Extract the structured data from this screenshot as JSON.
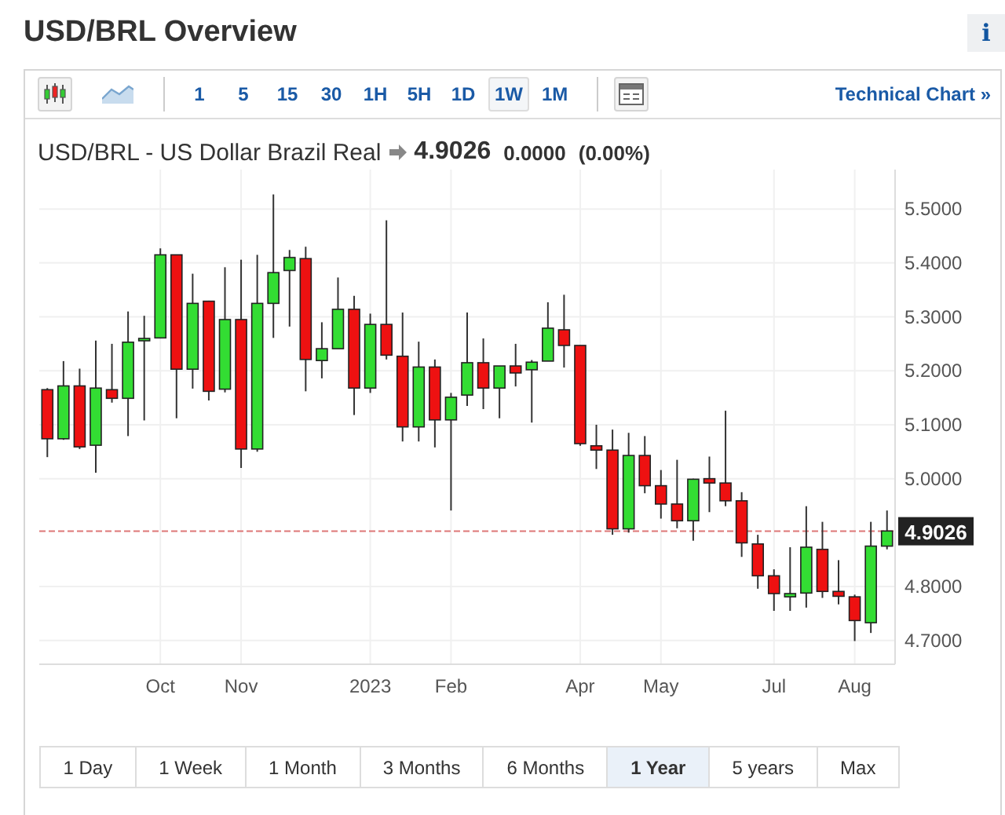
{
  "header": {
    "title": "USD/BRL Overview",
    "info_button": "i"
  },
  "toolbar": {
    "chart_types": [
      {
        "kind": "candles",
        "selected": true
      },
      {
        "kind": "area",
        "selected": false
      }
    ],
    "intervals": [
      {
        "label": "1",
        "selected": false
      },
      {
        "label": "5",
        "selected": false
      },
      {
        "label": "15",
        "selected": false
      },
      {
        "label": "30",
        "selected": false
      },
      {
        "label": "1H",
        "selected": false
      },
      {
        "label": "5H",
        "selected": false
      },
      {
        "label": "1D",
        "selected": false
      },
      {
        "label": "1W",
        "selected": true
      },
      {
        "label": "1M",
        "selected": false
      }
    ],
    "link": "Technical Chart »"
  },
  "quote": {
    "name": "USD/BRL - US Dollar Brazil Real",
    "price": "4.9026",
    "change": "0.0000",
    "change_pct": "(0.00%)"
  },
  "chart": {
    "chart_data": {
      "type": "candlestick",
      "grid": true,
      "ylim": [
        4.656,
        5.573
      ],
      "yticks": [
        {
          "value": 4.7,
          "label": "4.7000"
        },
        {
          "value": 4.8,
          "label": "4.8000"
        },
        {
          "value": 5.0,
          "label": "5.0000"
        },
        {
          "value": 5.1,
          "label": "5.1000"
        },
        {
          "value": 5.2,
          "label": "5.2000"
        },
        {
          "value": 5.3,
          "label": "5.3000"
        },
        {
          "value": 5.4,
          "label": "5.4000"
        },
        {
          "value": 5.5,
          "label": "5.5000"
        }
      ],
      "ref_lines": [
        {
          "axis": "y",
          "value": 4.9026,
          "label": "4.9026",
          "color": "#dd7777"
        }
      ],
      "categories": [
        null,
        null,
        null,
        null,
        null,
        null,
        null,
        "Oct",
        null,
        null,
        null,
        null,
        "Nov",
        null,
        null,
        null,
        null,
        null,
        null,
        null,
        "2023",
        null,
        null,
        null,
        null,
        "Feb",
        null,
        null,
        null,
        null,
        null,
        null,
        null,
        "Apr",
        null,
        null,
        null,
        null,
        "May",
        null,
        null,
        null,
        null,
        null,
        null,
        "Jul",
        null,
        null,
        null,
        null,
        "Aug",
        null,
        null
      ],
      "ohlc": [
        [
          5.165,
          5.168,
          5.04,
          5.074
        ],
        [
          5.074,
          5.218,
          5.072,
          5.172
        ],
        [
          5.172,
          5.204,
          5.055,
          5.059
        ],
        [
          5.062,
          5.256,
          5.011,
          5.168
        ],
        [
          5.165,
          5.25,
          5.141,
          5.149
        ],
        [
          5.149,
          5.31,
          5.079,
          5.253
        ],
        [
          5.256,
          5.302,
          5.108,
          5.26
        ],
        [
          5.261,
          5.427,
          5.26,
          5.415
        ],
        [
          5.415,
          5.415,
          5.112,
          5.203
        ],
        [
          5.203,
          5.38,
          5.167,
          5.325
        ],
        [
          5.329,
          5.33,
          5.145,
          5.162
        ],
        [
          5.166,
          5.392,
          5.16,
          5.295
        ],
        [
          5.295,
          5.406,
          5.02,
          5.055
        ],
        [
          5.055,
          5.415,
          5.05,
          5.325
        ],
        [
          5.325,
          5.527,
          5.261,
          5.382
        ],
        [
          5.386,
          5.424,
          5.282,
          5.41
        ],
        [
          5.408,
          5.43,
          5.162,
          5.221
        ],
        [
          5.219,
          5.29,
          5.186,
          5.241
        ],
        [
          5.241,
          5.373,
          5.241,
          5.314
        ],
        [
          5.314,
          5.339,
          5.118,
          5.168
        ],
        [
          5.168,
          5.306,
          5.159,
          5.286
        ],
        [
          5.286,
          5.479,
          5.221,
          5.229
        ],
        [
          5.227,
          5.308,
          5.069,
          5.096
        ],
        [
          5.096,
          5.254,
          5.069,
          5.207
        ],
        [
          5.207,
          5.221,
          5.058,
          5.109
        ],
        [
          5.109,
          5.159,
          4.941,
          5.151
        ],
        [
          5.155,
          5.308,
          5.135,
          5.215
        ],
        [
          5.215,
          5.26,
          5.129,
          5.168
        ],
        [
          5.168,
          5.209,
          5.112,
          5.209
        ],
        [
          5.209,
          5.25,
          5.171,
          5.196
        ],
        [
          5.202,
          5.22,
          5.104,
          5.216
        ],
        [
          5.218,
          5.327,
          5.218,
          5.279
        ],
        [
          5.276,
          5.341,
          5.206,
          5.247
        ],
        [
          5.247,
          5.247,
          5.061,
          5.065
        ],
        [
          5.061,
          5.1,
          5.018,
          5.053
        ],
        [
          5.053,
          5.091,
          4.896,
          4.907
        ],
        [
          4.907,
          5.085,
          4.9,
          5.043
        ],
        [
          5.043,
          5.079,
          4.973,
          4.987
        ],
        [
          4.987,
          5.016,
          4.926,
          4.953
        ],
        [
          4.953,
          5.035,
          4.908,
          4.922
        ],
        [
          4.922,
          5.0,
          4.885,
          4.999
        ],
        [
          5.0,
          5.041,
          4.938,
          4.992
        ],
        [
          4.992,
          5.126,
          4.949,
          4.959
        ],
        [
          4.959,
          4.975,
          4.855,
          4.881
        ],
        [
          4.879,
          4.896,
          4.796,
          4.82
        ],
        [
          4.82,
          4.832,
          4.755,
          4.787
        ],
        [
          4.781,
          4.873,
          4.755,
          4.787
        ],
        [
          4.788,
          4.949,
          4.761,
          4.873
        ],
        [
          4.869,
          4.92,
          4.779,
          4.791
        ],
        [
          4.791,
          4.849,
          4.767,
          4.782
        ],
        [
          4.781,
          4.785,
          4.699,
          4.737
        ],
        [
          4.733,
          4.92,
          4.714,
          4.875
        ],
        [
          4.875,
          4.941,
          4.869,
          4.903
        ]
      ]
    }
  },
  "ranges": [
    {
      "label": "1 Day",
      "selected": false
    },
    {
      "label": "1 Week",
      "selected": false
    },
    {
      "label": "1 Month",
      "selected": false
    },
    {
      "label": "3 Months",
      "selected": false
    },
    {
      "label": "6 Months",
      "selected": false
    },
    {
      "label": "1 Year",
      "selected": true
    },
    {
      "label": "5 years",
      "selected": false
    },
    {
      "label": "Max",
      "selected": false
    }
  ]
}
